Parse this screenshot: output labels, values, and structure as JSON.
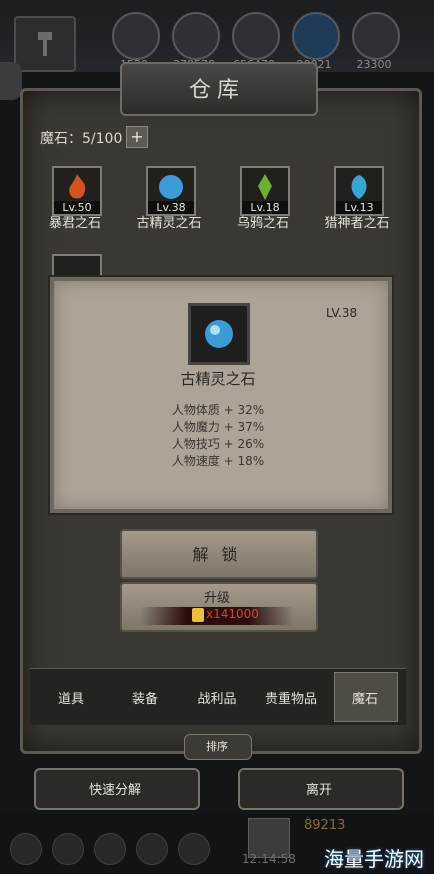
{
  "topbar": {
    "resources": [
      {
        "icon": "wood-icon",
        "value": "1520"
      },
      {
        "icon": "log-icon",
        "value": "378570"
      },
      {
        "icon": "stone-icon",
        "value": "656470"
      },
      {
        "icon": "crystal-icon",
        "value": "20021"
      },
      {
        "icon": "iron-icon",
        "value": "23300"
      }
    ]
  },
  "window": {
    "title": "仓库",
    "capacity_label": "魔石：5/100",
    "capacity_plus": "+"
  },
  "stones": [
    {
      "lv": "Lv.50",
      "name": "暴君之石",
      "color": "#d2541e"
    },
    {
      "lv": "Lv.38",
      "name": "古精灵之石",
      "color": "#3a9bd6"
    },
    {
      "lv": "Lv.18",
      "name": "乌鸦之石",
      "color": "#6fb02c"
    },
    {
      "lv": "Lv.13",
      "name": "猎神者之石",
      "color": "#37a6d3"
    }
  ],
  "detail": {
    "level": "LV.38",
    "name": "古精灵之石",
    "stats": [
      "人物体质 + 32%",
      "人物魔力 + 37%",
      "人物技巧 + 26%",
      "人物速度 + 18%"
    ]
  },
  "actions": {
    "unlock_label": "解 锁",
    "upgrade_label": "升级",
    "upgrade_cost": "x141000"
  },
  "tabs": [
    {
      "label": "道具"
    },
    {
      "label": "装备"
    },
    {
      "label": "战利品"
    },
    {
      "label": "贵重物品"
    },
    {
      "label": "魔石"
    }
  ],
  "sort_label": "排序",
  "bottom_buttons": {
    "decompose": "快速分解",
    "leave": "离开"
  },
  "footer": {
    "gold": "89213",
    "time": "12:14:58"
  },
  "watermark": "海量手游网",
  "colors": {
    "accent_red": "#e23b2b",
    "panel": "#3b3732",
    "card": "#ada497"
  }
}
